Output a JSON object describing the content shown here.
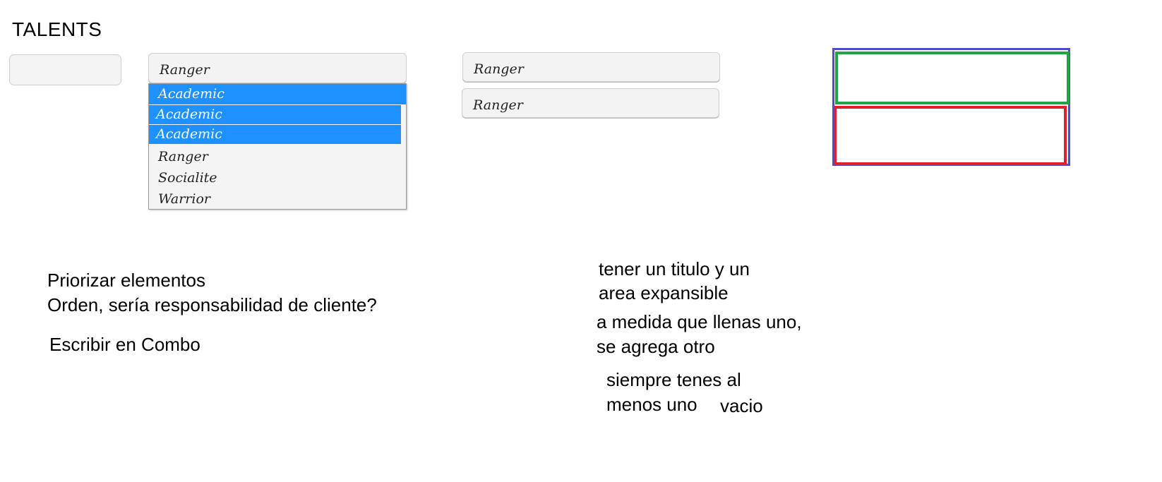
{
  "header": {
    "title": "TALENTS"
  },
  "combo_main": {
    "value": "Ranger",
    "options": [
      {
        "label": "Academic",
        "selected": true
      },
      {
        "label": "Academic",
        "selected": true
      },
      {
        "label": "Academic",
        "selected": true
      },
      {
        "label": "Ranger",
        "selected": false
      },
      {
        "label": "Socialite",
        "selected": false
      },
      {
        "label": "Warrior",
        "selected": false
      }
    ]
  },
  "combo_right": [
    {
      "value": "Ranger"
    },
    {
      "value": "Ranger"
    }
  ],
  "notes_left": {
    "line1": "Priorizar elementos",
    "line2": "Orden, sería responsabilidad de cliente?",
    "line3": "Escribir en Combo"
  },
  "notes_right": {
    "line1": "tener un titulo y un",
    "line2": "area expansible",
    "line3": "a medida que llenas uno,",
    "line4": "se agrega otro",
    "line5": "siempre tenes al",
    "line6": "menos uno",
    "line7": "vacio"
  },
  "colors": {
    "selection": "#1e90ff",
    "frame_outer": "#4d4dcc",
    "frame_top": "#21a34a",
    "frame_bottom": "#e3202a"
  }
}
